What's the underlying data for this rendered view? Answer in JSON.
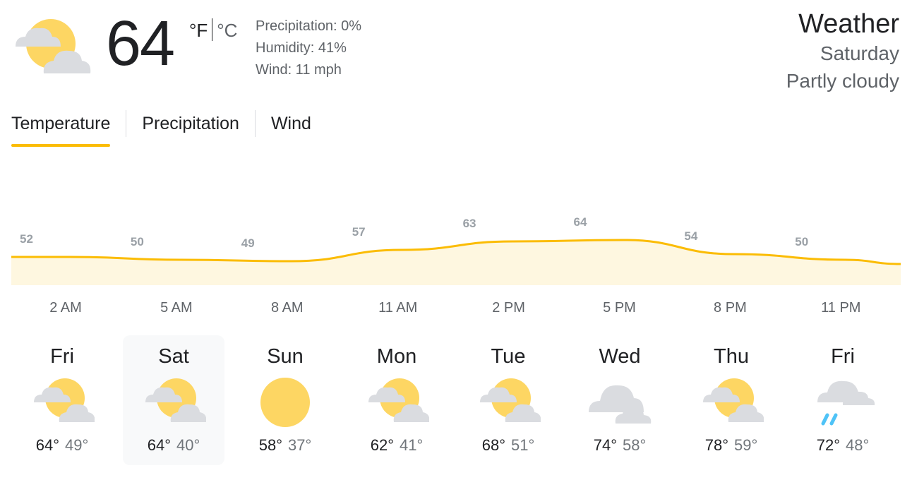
{
  "current": {
    "temp": "64",
    "unit_f": "°F",
    "unit_c": "°C",
    "precipitation": "Precipitation: 0%",
    "humidity": "Humidity: 41%",
    "wind": "Wind: 11 mph",
    "condition_icon": "partly-cloudy-icon"
  },
  "header": {
    "title": "Weather",
    "day": "Saturday",
    "condition": "Partly cloudy"
  },
  "tabs": [
    {
      "label": "Temperature",
      "active": true
    },
    {
      "label": "Precipitation",
      "active": false
    },
    {
      "label": "Wind",
      "active": false
    }
  ],
  "colors": {
    "accent": "#fbbc04",
    "chart_fill": "#fef7e0",
    "sun": "#fdd663",
    "cloud": "#dadce0",
    "rain": "#4fc3f7"
  },
  "chart_data": {
    "type": "area",
    "x": [
      "2 AM",
      "5 AM",
      "8 AM",
      "11 AM",
      "2 PM",
      "5 PM",
      "8 PM",
      "11 PM"
    ],
    "values": [
      52,
      50,
      49,
      57,
      63,
      64,
      54,
      50
    ],
    "labels": [
      "52",
      "50",
      "49",
      "57",
      "63",
      "64",
      "54",
      "50"
    ],
    "series": [
      {
        "values": [
          52,
          50,
          49,
          57,
          63,
          64,
          54,
          50
        ]
      }
    ]
  },
  "forecast": [
    {
      "day": "Fri",
      "icon": "partly-cloudy-icon",
      "high": "64°",
      "low": "49°"
    },
    {
      "day": "Sat",
      "icon": "partly-cloudy-icon",
      "high": "64°",
      "low": "40°",
      "selected": true
    },
    {
      "day": "Sun",
      "icon": "sunny-icon",
      "high": "58°",
      "low": "37°"
    },
    {
      "day": "Mon",
      "icon": "partly-cloudy-icon",
      "high": "62°",
      "low": "41°"
    },
    {
      "day": "Tue",
      "icon": "partly-cloudy-icon",
      "high": "68°",
      "low": "51°"
    },
    {
      "day": "Wed",
      "icon": "cloudy-icon",
      "high": "74°",
      "low": "58°"
    },
    {
      "day": "Thu",
      "icon": "partly-cloudy-icon",
      "high": "78°",
      "low": "59°"
    },
    {
      "day": "Fri",
      "icon": "rain-icon",
      "high": "72°",
      "low": "48°"
    }
  ]
}
